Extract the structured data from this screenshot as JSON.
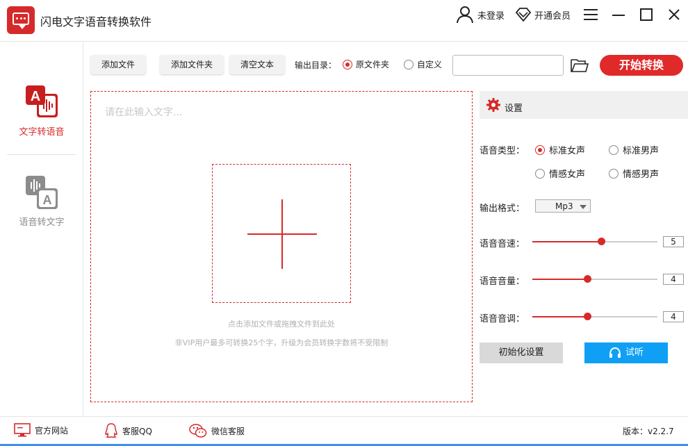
{
  "app": {
    "title": "闪电文字语音转换软件",
    "accent_color": "#d62a2a",
    "icon": "chat-bubble-logo-icon"
  },
  "header": {
    "user_label": "未登录",
    "vip_label": "开通会员",
    "menu_icon": "hamburger-menu-icon",
    "minimize_icon": "minimize-icon",
    "maximize_icon": "maximize-icon",
    "close_icon": "close-icon"
  },
  "sidebar": {
    "items": [
      {
        "label": "文字转语音",
        "icon": "text-to-speech-icon",
        "active": true
      },
      {
        "label": "语音转文字",
        "icon": "speech-to-text-icon",
        "active": false
      }
    ]
  },
  "toolbar": {
    "add_file": "添加文件",
    "add_folder": "添加文件夹",
    "clear_text": "清空文本",
    "output_label": "输出目录：",
    "output_options": [
      "原文件夹",
      "自定义"
    ],
    "output_selected": "原文件夹",
    "path_value": "",
    "convert_label": "开始转换"
  },
  "editor": {
    "placeholder": "请在此输入文字...",
    "hint_drop": "点击添加文件或拖拽文件到此处",
    "hint_vip": "非VIP用户最多可转换25个字，升级为会员转换字数将不受限制"
  },
  "settings": {
    "title": "设置",
    "voice_type_label": "语音类型：",
    "voice_types": [
      "标准女声",
      "标准男声",
      "情感女声",
      "情感男声"
    ],
    "voice_type_selected": "标准女声",
    "format_label": "输出格式：",
    "format_value": "Mp3",
    "speed_label": "语音音速：",
    "speed_value": "5",
    "speed_fraction": 0.55,
    "volume_label": "语音音量：",
    "volume_value": "4",
    "volume_fraction": 0.44,
    "pitch_label": "语音音调：",
    "pitch_value": "4",
    "pitch_fraction": 0.44,
    "reset_label": "初始化设置",
    "listen_label": "试听"
  },
  "statusbar": {
    "website": "官方网站",
    "qq": "客服QQ",
    "wechat": "微信客服",
    "version": "版本：v2.2.7"
  }
}
